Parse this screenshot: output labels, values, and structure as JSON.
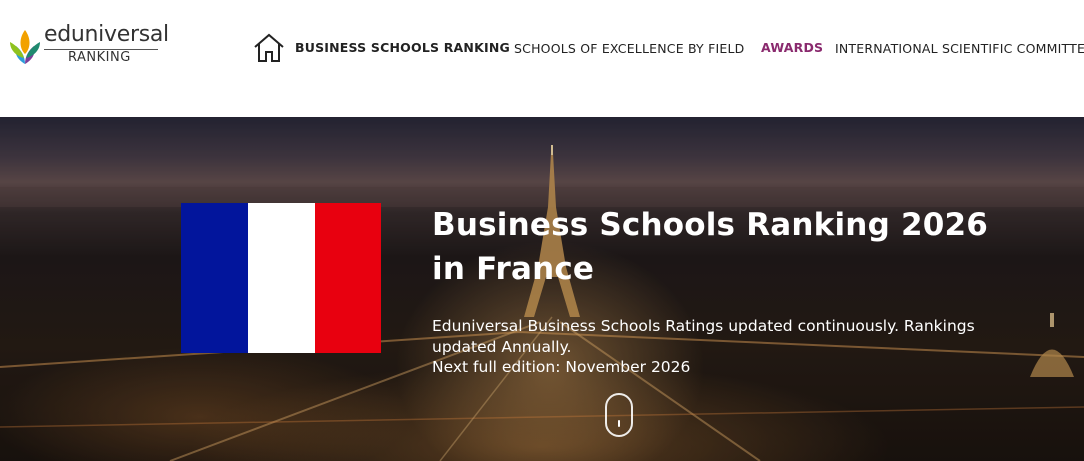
{
  "logo": {
    "word": "eduniversal",
    "sub": "RANKING",
    "colors": [
      "#f2a100",
      "#8fc21f",
      "#2d9cdb",
      "#7b3f9a",
      "#1f8a6f"
    ]
  },
  "nav": {
    "home_icon": "home-icon",
    "items": [
      "BUSINESS SCHOOLS RANKING",
      "SCHOOLS OF EXCELLENCE BY FIELD",
      "AWARDS",
      "INTERNATIONAL SCIENTIFIC COMMITTEE"
    ],
    "awards_color": "#8a2a6e"
  },
  "hero": {
    "title": "Business Schools Ranking 2026 in France",
    "description": "Eduniversal Business Schools Ratings updated continuously. Rankings updated Annually.",
    "next_edition": "Next full edition: November 2026",
    "flag_colors": [
      "#02159c",
      "#ffffff",
      "#e8000f"
    ],
    "scroll_icon": "mouse-scroll-icon"
  }
}
